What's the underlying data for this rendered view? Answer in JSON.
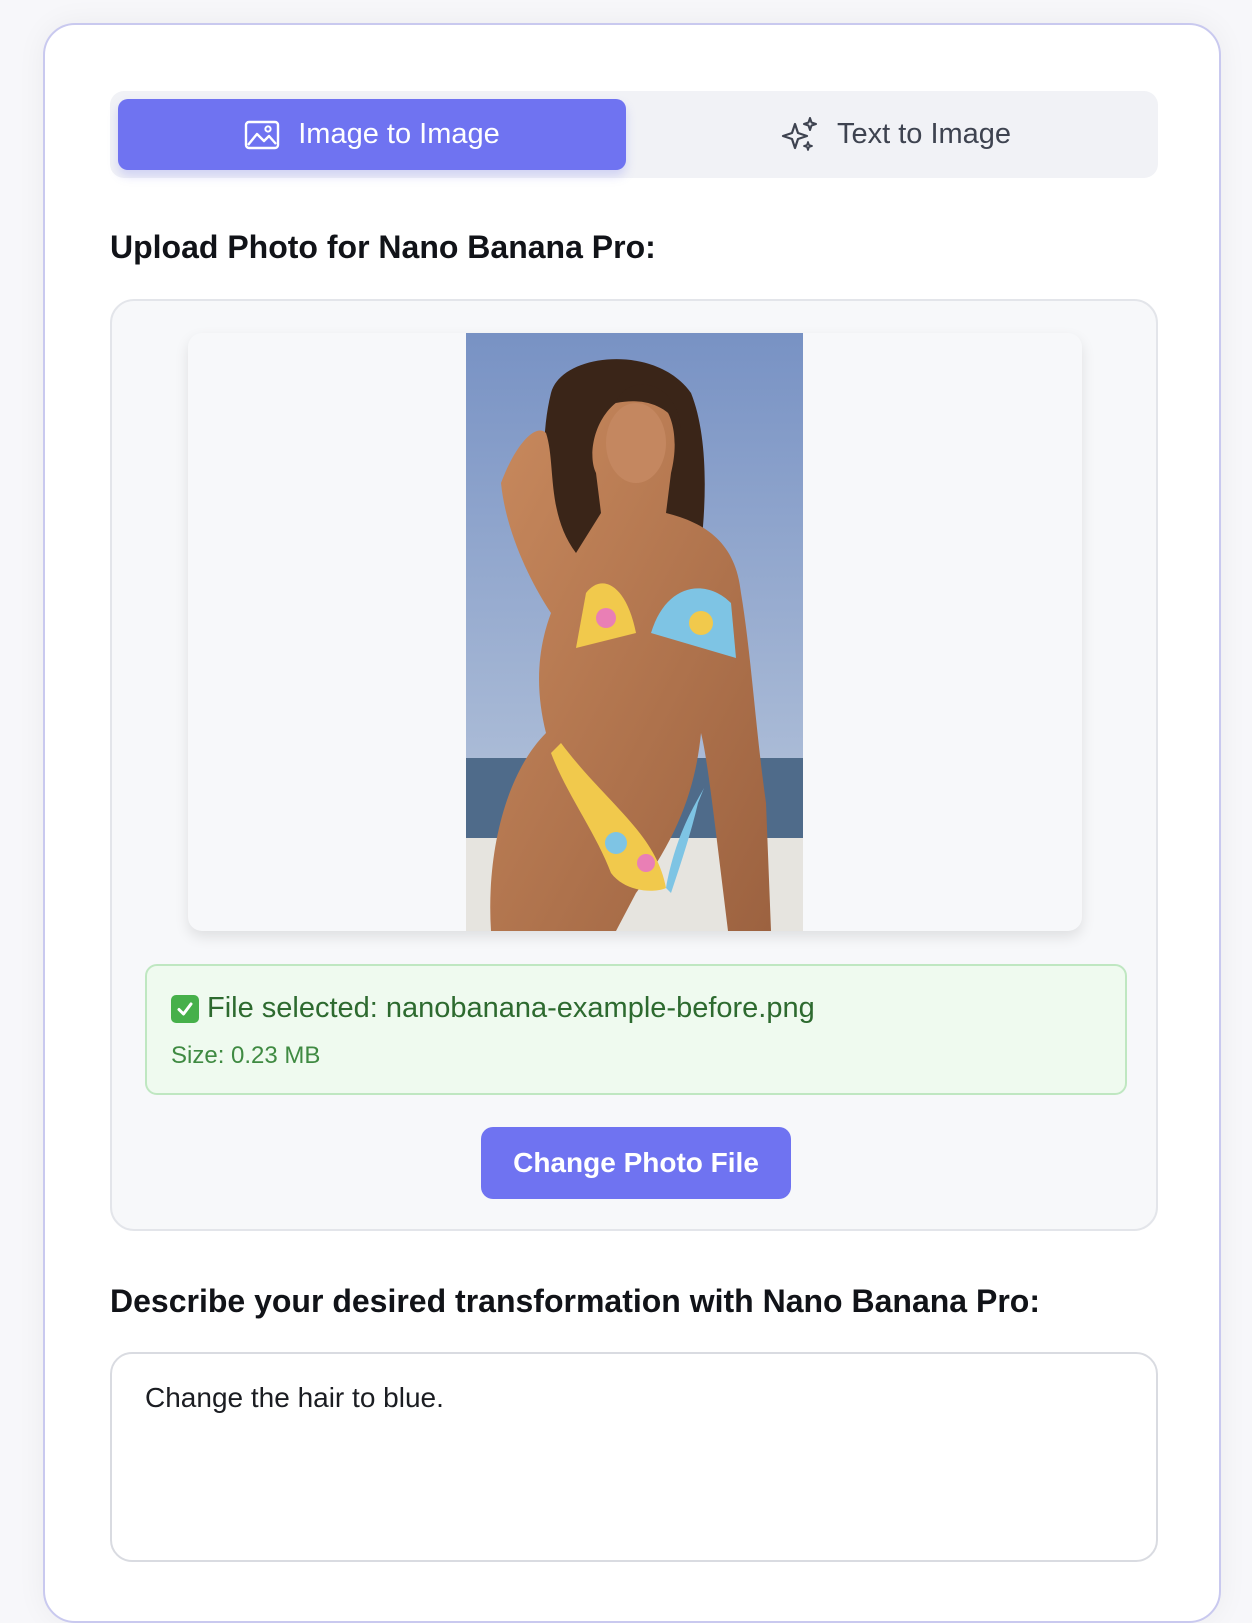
{
  "tabs": [
    {
      "label": "Image to Image",
      "icon": "image-icon",
      "active": true
    },
    {
      "label": "Text to Image",
      "icon": "sparkles-icon",
      "active": false
    }
  ],
  "upload": {
    "heading": "Upload Photo for Nano Banana Pro:",
    "file_line_prefix": "File selected:",
    "file_name": "nanobanana-example-before.png",
    "size_text": "Size: 0.23 MB",
    "change_button": "Change Photo File"
  },
  "prompt": {
    "heading": "Describe your desired transformation with Nano Banana Pro:",
    "value": "Change the hair to blue."
  },
  "colors": {
    "accent": "#6f73f1",
    "success_bg": "#effaef",
    "success_text": "#2d6a2f",
    "card_border": "#c9c9ef"
  }
}
